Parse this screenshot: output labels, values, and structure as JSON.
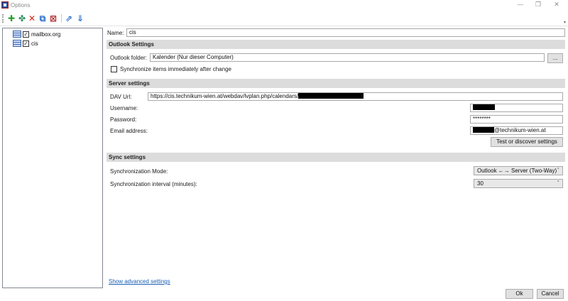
{
  "window": {
    "title": "Options",
    "minimize_glyph": "—",
    "restore_glyph": "❐",
    "close_glyph": "✕"
  },
  "toolbar": {
    "icons": [
      "add-icon",
      "copy-profile-icon",
      "delete-icon",
      "clear-cache-icon",
      "delete-cache-icon",
      "export-icon",
      "import-icon"
    ],
    "add_glyph": "✚",
    "copy_glyph": "✤",
    "delete_glyph": "✕",
    "clear_glyph": "⧉",
    "delete_cache_glyph": "⊠",
    "export_glyph": "⇗",
    "import_glyph": "⇓",
    "overflow_glyph": "▾",
    "colors": {
      "add": "#2e9e2e",
      "delete": "#d9261c",
      "accent": "#2a6fc9"
    }
  },
  "tree": {
    "items": [
      {
        "label": "mailbox.org",
        "checked": "✓"
      },
      {
        "label": "cis",
        "checked": "✓"
      }
    ]
  },
  "profile": {
    "name_label": "Name:",
    "name_value": "cis"
  },
  "outlook": {
    "header": "Outlook Settings",
    "folder_label": "Outlook folder:",
    "folder_value": "Kalender (Nur dieser Computer)",
    "browse_label": "...",
    "sync_immediately_label": "Synchronize items immediately after change"
  },
  "server": {
    "header": "Server settings",
    "dav_label": "DAV Url:",
    "dav_value": "https://cis.technikum-wien.at/webdav/lvplan.php/calendars/",
    "username_label": "Username:",
    "password_label": "Password:",
    "password_value": "********",
    "email_label": "Email address:",
    "email_domain": "@technikum-wien.at",
    "test_button": "Test or discover settings"
  },
  "sync": {
    "header": "Sync settings",
    "mode_label": "Synchronization Mode:",
    "mode_value": "Outlook ←→ Server (Two-Way)",
    "interval_label": "Synchronization interval (minutes):",
    "interval_value": "30",
    "dropdown_glyph": "˅"
  },
  "footer": {
    "advanced_link": "Show advanced settings",
    "ok": "Ok",
    "cancel": "Cancel"
  }
}
